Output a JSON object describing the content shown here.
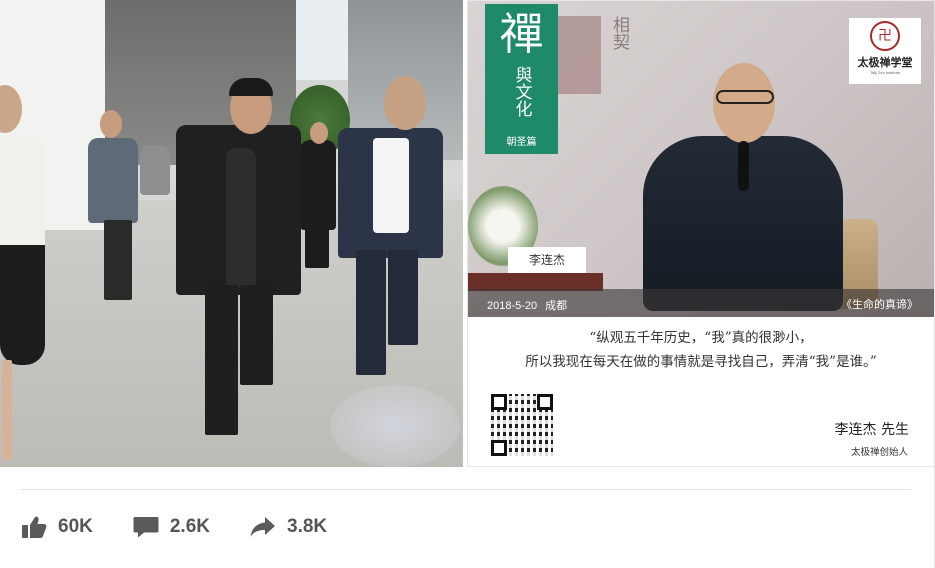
{
  "poster": {
    "series_big": "禪",
    "series_mid": "與文化",
    "series_small": "朝圣篇",
    "corner_text": "相契",
    "logo_text": "太极禅学堂",
    "logo_sub": "Taiji Zen Institute",
    "name_card": "李连杰",
    "caption_date": "2018-5-20",
    "caption_city": "成都",
    "caption_title": "《生命的真谛》",
    "quote_line1": "“纵观五千年历史，“我”真的很渺小，",
    "quote_line2": "所以我现在每天在做的事情就是寻找自己，弄清“我”是谁。”",
    "signature_name": "李连杰 先生",
    "signature_role": "太极禅创始人"
  },
  "reactions": {
    "likes": "60K",
    "comments": "2.6K",
    "shares": "3.8K"
  },
  "colors": {
    "green": "#1f8a6a",
    "reaction_gray": "#555555"
  }
}
